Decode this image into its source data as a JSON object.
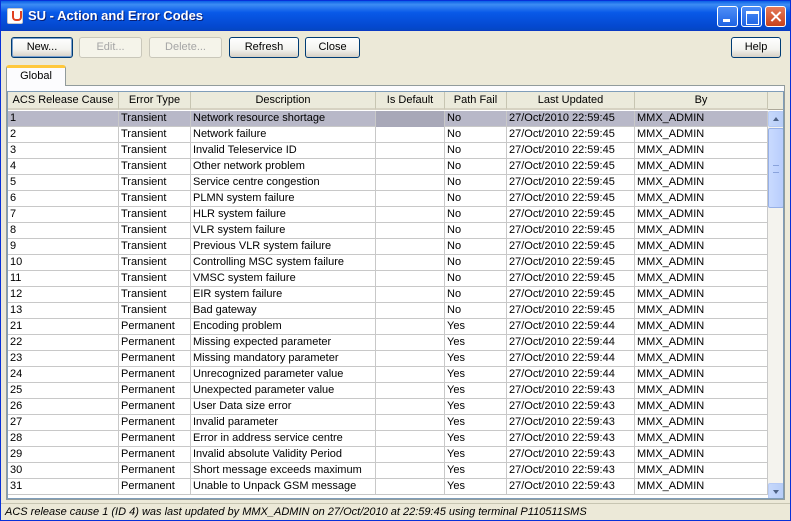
{
  "window": {
    "title": "SU - Action and Error Codes",
    "controls": [
      "minimize-icon",
      "maximize-icon",
      "close-icon"
    ]
  },
  "toolbar": {
    "new_label": "New...",
    "edit_label": "Edit...",
    "delete_label": "Delete...",
    "refresh_label": "Refresh",
    "close_label": "Close",
    "help_label": "Help"
  },
  "tabs": [
    {
      "label": "Global",
      "selected": true
    }
  ],
  "table": {
    "columns": [
      "ACS Release Cause",
      "Error Type",
      "Description",
      "Is Default",
      "Path Fail",
      "Last Updated",
      "By"
    ],
    "rows": [
      [
        "1",
        "Transient",
        "Network resource shortage",
        "",
        "No",
        "27/Oct/2010 22:59:45",
        "MMX_ADMIN"
      ],
      [
        "2",
        "Transient",
        "Network failure",
        "",
        "No",
        "27/Oct/2010 22:59:45",
        "MMX_ADMIN"
      ],
      [
        "3",
        "Transient",
        "Invalid Teleservice ID",
        "",
        "No",
        "27/Oct/2010 22:59:45",
        "MMX_ADMIN"
      ],
      [
        "4",
        "Transient",
        "Other network problem",
        "",
        "No",
        "27/Oct/2010 22:59:45",
        "MMX_ADMIN"
      ],
      [
        "5",
        "Transient",
        "Service centre congestion",
        "",
        "No",
        "27/Oct/2010 22:59:45",
        "MMX_ADMIN"
      ],
      [
        "6",
        "Transient",
        "PLMN system failure",
        "",
        "No",
        "27/Oct/2010 22:59:45",
        "MMX_ADMIN"
      ],
      [
        "7",
        "Transient",
        "HLR system failure",
        "",
        "No",
        "27/Oct/2010 22:59:45",
        "MMX_ADMIN"
      ],
      [
        "8",
        "Transient",
        "VLR system failure",
        "",
        "No",
        "27/Oct/2010 22:59:45",
        "MMX_ADMIN"
      ],
      [
        "9",
        "Transient",
        "Previous VLR system failure",
        "",
        "No",
        "27/Oct/2010 22:59:45",
        "MMX_ADMIN"
      ],
      [
        "10",
        "Transient",
        "Controlling MSC system failure",
        "",
        "No",
        "27/Oct/2010 22:59:45",
        "MMX_ADMIN"
      ],
      [
        "11",
        "Transient",
        "VMSC system failure",
        "",
        "No",
        "27/Oct/2010 22:59:45",
        "MMX_ADMIN"
      ],
      [
        "12",
        "Transient",
        "EIR system failure",
        "",
        "No",
        "27/Oct/2010 22:59:45",
        "MMX_ADMIN"
      ],
      [
        "13",
        "Transient",
        "Bad gateway",
        "",
        "No",
        "27/Oct/2010 22:59:45",
        "MMX_ADMIN"
      ],
      [
        "21",
        "Permanent",
        "Encoding problem",
        "",
        "Yes",
        "27/Oct/2010 22:59:44",
        "MMX_ADMIN"
      ],
      [
        "22",
        "Permanent",
        "Missing expected parameter",
        "",
        "Yes",
        "27/Oct/2010 22:59:44",
        "MMX_ADMIN"
      ],
      [
        "23",
        "Permanent",
        "Missing mandatory parameter",
        "",
        "Yes",
        "27/Oct/2010 22:59:44",
        "MMX_ADMIN"
      ],
      [
        "24",
        "Permanent",
        "Unrecognized parameter value",
        "",
        "Yes",
        "27/Oct/2010 22:59:44",
        "MMX_ADMIN"
      ],
      [
        "25",
        "Permanent",
        "Unexpected parameter value",
        "",
        "Yes",
        "27/Oct/2010 22:59:43",
        "MMX_ADMIN"
      ],
      [
        "26",
        "Permanent",
        "User Data size error",
        "",
        "Yes",
        "27/Oct/2010 22:59:43",
        "MMX_ADMIN"
      ],
      [
        "27",
        "Permanent",
        "Invalid parameter",
        "",
        "Yes",
        "27/Oct/2010 22:59:43",
        "MMX_ADMIN"
      ],
      [
        "28",
        "Permanent",
        "Error in address service centre",
        "",
        "Yes",
        "27/Oct/2010 22:59:43",
        "MMX_ADMIN"
      ],
      [
        "29",
        "Permanent",
        "Invalid absolute Validity Period",
        "",
        "Yes",
        "27/Oct/2010 22:59:43",
        "MMX_ADMIN"
      ],
      [
        "30",
        "Permanent",
        "Short message exceeds maximum",
        "",
        "Yes",
        "27/Oct/2010 22:59:43",
        "MMX_ADMIN"
      ],
      [
        "31",
        "Permanent",
        "Unable to Unpack GSM message",
        "",
        "Yes",
        "27/Oct/2010 22:59:43",
        "MMX_ADMIN"
      ]
    ],
    "selected_row_index": 0,
    "scroll_fraction": 0.0
  },
  "status": {
    "text": "ACS release cause 1 (ID 4) was last updated by MMX_ADMIN on 27/Oct/2010 at 22:59:45 using terminal P110511SMS"
  },
  "colors": {
    "titlebar": "#0a5fe6",
    "window_bg": "#ece9d8",
    "selected_row": "#b8b8c8",
    "tab_accent": "#ffc83c"
  }
}
